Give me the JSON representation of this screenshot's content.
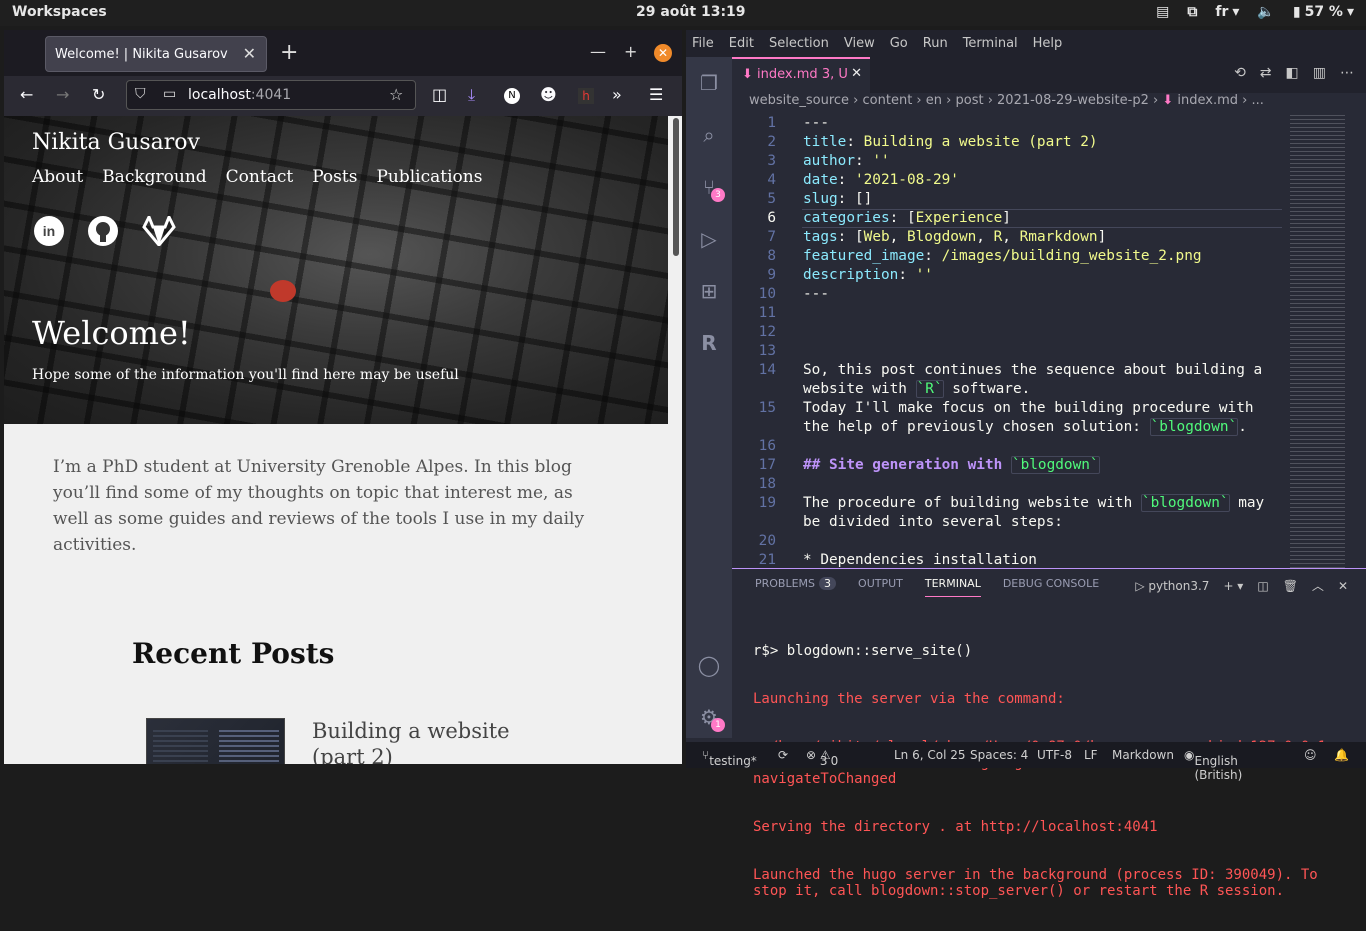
{
  "topbar": {
    "workspaces": "Workspaces",
    "clock": "29 août  13:19",
    "language": "fr",
    "battery": "57 %"
  },
  "browser": {
    "tab_title": "Welcome! | Nikita Gusarov",
    "url_host": "localhost",
    "url_port": ":4041",
    "page": {
      "site_title": "Nikita Gusarov",
      "menu": [
        "About",
        "Background",
        "Contact",
        "Posts",
        "Publications"
      ],
      "welcome": "Welcome!",
      "subtitle": "Hope some of the information you'll find here may be useful",
      "intro": "I’m a PhD student at University Grenoble Alpes. In this blog you’ll find some of my thoughts on topic that interest me, as well as some guides and reviews of the tools I use in my daily activities.",
      "recent_heading": "Recent Posts",
      "post_title": "Building a website (part 2)"
    }
  },
  "vscode": {
    "menu": [
      "File",
      "Edit",
      "Selection",
      "View",
      "Go",
      "Run",
      "Terminal",
      "Help"
    ],
    "tab": {
      "name": "index.md",
      "status": "3, U"
    },
    "breadcrumb": [
      "website_source",
      "content",
      "en",
      "post",
      "2021-08-29-website-p2",
      "index.md",
      "..."
    ],
    "panel_tabs": {
      "problems": "PROBLEMS",
      "problems_count": "3",
      "output": "OUTPUT",
      "terminal": "TERMINAL",
      "debug": "DEBUG CONSOLE",
      "shell": "python3.7"
    },
    "terminal": {
      "prompt": "r$> blogdown::serve_site()",
      "lines": [
        "Launching the server via the command:",
        "  /home/nikita/.local/share/Hugo/0.87.0/hugo server --bind 127.0.0.1 -p 4041 --themesDir themes -t gohugo-theme-ananke -D -F --navigateToChanged",
        "Serving the directory . at http://localhost:4041",
        "Launched the hugo server in the background (process ID: 390049). To stop it, call blogdown::stop_server() or restart the R session."
      ]
    },
    "status": {
      "branch": "testing*",
      "errors": "3",
      "warnings": "0",
      "position": "Ln 6, Col 25",
      "spaces": "Spaces: 4",
      "encoding": "UTF-8",
      "eol": "LF",
      "language": "Markdown",
      "spell": "English (British)"
    },
    "activity_badges": {
      "scm": "3",
      "settings": "1"
    }
  }
}
